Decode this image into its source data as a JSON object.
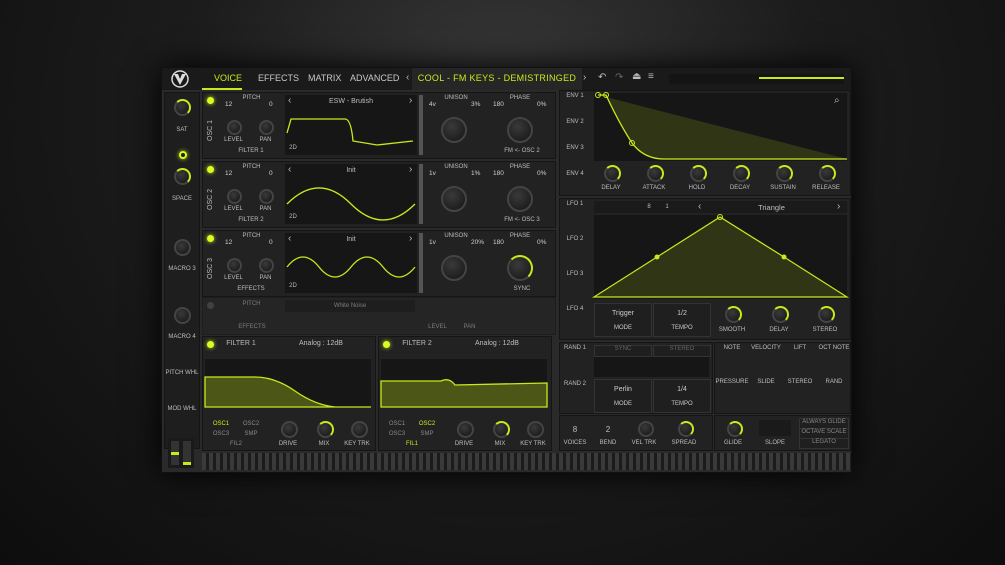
{
  "tabs": {
    "voice": "VOICE",
    "effects": "EFFECTS",
    "matrix": "MATRIX",
    "advanced": "ADVANCED"
  },
  "preset": "COOL - FM KEYS - DEMISTRINGED",
  "macros": {
    "m1": "SAT",
    "m2": "SPACE",
    "m3": "MACRO 3",
    "m4": "MACRO 4",
    "pitch": "PITCH WHL",
    "mod": "MOD WHL"
  },
  "osc": [
    {
      "label": "OSC 1",
      "pitch": "PITCH",
      "oct": "12",
      "fine": "0",
      "level": "LEVEL",
      "pan": "PAN",
      "dest": "FILTER 1",
      "wave": "ESW - Brutish",
      "mode": "2D",
      "unison": "UNISON",
      "voices": "4v",
      "detune": "3%",
      "phase": "PHASE",
      "phval": "180",
      "phpct": "0%",
      "fm": "FM <- OSC 2"
    },
    {
      "label": "OSC 2",
      "pitch": "PITCH",
      "oct": "12",
      "fine": "0",
      "level": "LEVEL",
      "pan": "PAN",
      "dest": "FILTER 2",
      "wave": "Init",
      "mode": "2D",
      "unison": "UNISON",
      "voices": "1v",
      "detune": "1%",
      "phase": "PHASE",
      "phval": "180",
      "phpct": "0%",
      "fm": "FM <- OSC 3"
    },
    {
      "label": "OSC 3",
      "pitch": "PITCH",
      "oct": "12",
      "fine": "0",
      "level": "LEVEL",
      "pan": "PAN",
      "dest": "EFFECTS",
      "wave": "Init",
      "mode": "2D",
      "unison": "UNISON",
      "voices": "1v",
      "detune": "20%",
      "phase": "PHASE",
      "phval": "180",
      "phpct": "0%",
      "fm": "SYNC"
    }
  ],
  "smp": {
    "wave": "White Noise",
    "pitch": "PITCH",
    "level": "LEVEL",
    "pan": "PAN",
    "dest": "EFFECTS"
  },
  "filters": [
    {
      "title": "FILTER 1",
      "type": "Analog : 12dB",
      "src1": "OSC1",
      "src2": "OSC2",
      "src3": "OSC3",
      "src4": "SMP",
      "route": "FIL2",
      "drive": "DRIVE",
      "mix": "MIX",
      "keytrk": "KEY TRK"
    },
    {
      "title": "FILTER 2",
      "type": "Analog : 12dB",
      "src1": "OSC1",
      "src2": "OSC2",
      "src3": "OSC3",
      "src4": "SMP",
      "route": "FIL1",
      "drive": "DRIVE",
      "mix": "MIX",
      "keytrk": "KEY TRK"
    }
  ],
  "env": {
    "tabs": [
      "ENV 1",
      "ENV 2",
      "ENV 3",
      "ENV 4"
    ],
    "knobs": [
      "DELAY",
      "ATTACK",
      "HOLD",
      "DECAY",
      "SUSTAIN",
      "RELEASE"
    ]
  },
  "lfo": {
    "tabs": [
      "LFO 1",
      "LFO 2",
      "LFO 3",
      "LFO 4"
    ],
    "n1": "8",
    "n2": "1",
    "shape": "Triangle",
    "mode_val": "Trigger",
    "mode": "MODE",
    "tempo_val": "1/2",
    "tempo": "TEMPO",
    "smooth": "SMOOTH",
    "delay": "DELAY",
    "stereo": "STEREO"
  },
  "rand": {
    "tabs": [
      "RAND 1",
      "RAND 2"
    ],
    "sync": "SYNC",
    "stereo": "STEREO",
    "style": "Perlin",
    "mode": "MODE",
    "tempo_val": "1/4",
    "tempo": "TEMPO"
  },
  "mod": {
    "items": [
      "NOTE",
      "VELOCITY",
      "LIFT",
      "OCT NOTE",
      "PRESSURE",
      "SLIDE",
      "STEREO",
      "RAND"
    ]
  },
  "voice": {
    "voices_val": "8",
    "voices": "VOICES",
    "bend_val": "2",
    "bend": "BEND",
    "veltrk": "VEL TRK",
    "spread": "SPREAD",
    "glide": "GLIDE",
    "slope": "SLOPE",
    "always": "ALWAYS GLIDE",
    "octave": "OCTAVE SCALE",
    "legato": "LEGATO"
  },
  "colors": {
    "accent": "#c8ea1c",
    "panel": "#222222",
    "bg": "#2a2a2a"
  }
}
